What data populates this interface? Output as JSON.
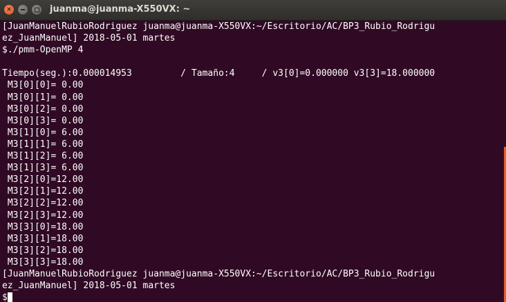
{
  "window": {
    "title": "juanma@juanma-X550VX: ~",
    "buttons": {
      "close": "close",
      "minimize": "minimize",
      "maximize": "maximize"
    }
  },
  "terminal": {
    "lines": [
      "[JuanManuelRubioRodriguez juanma@juanma-X550VX:~/Escritorio/AC/BP3_Rubio_Rodrigu",
      "ez_JuanManuel] 2018-05-01 martes",
      "$./pmm-OpenMP 4",
      "",
      "Tiempo(seg.):0.000014953         / Tamaño:4     / v3[0]=0.000000 v3[3]=18.000000",
      " M3[0][0]= 0.00",
      " M3[0][1]= 0.00",
      " M3[0][2]= 0.00",
      " M3[0][3]= 0.00",
      " M3[1][0]= 6.00",
      " M3[1][1]= 6.00",
      " M3[1][2]= 6.00",
      " M3[1][3]= 6.00",
      " M3[2][0]=12.00",
      " M3[2][1]=12.00",
      " M3[2][2]=12.00",
      " M3[2][3]=12.00",
      " M3[3][0]=18.00",
      " M3[3][1]=18.00",
      " M3[3][2]=18.00",
      " M3[3][3]=18.00",
      "[JuanManuelRubioRodriguez juanma@juanma-X550VX:~/Escritorio/AC/BP3_Rubio_Rodrigu",
      "ez_JuanManuel] 2018-05-01 martes"
    ],
    "prompt": "$"
  },
  "colors": {
    "background": "#300a24",
    "text": "#ffffff",
    "titlebar": "#3c3b37",
    "close_button": "#e0561f",
    "scrollbar": "#e35e28"
  }
}
